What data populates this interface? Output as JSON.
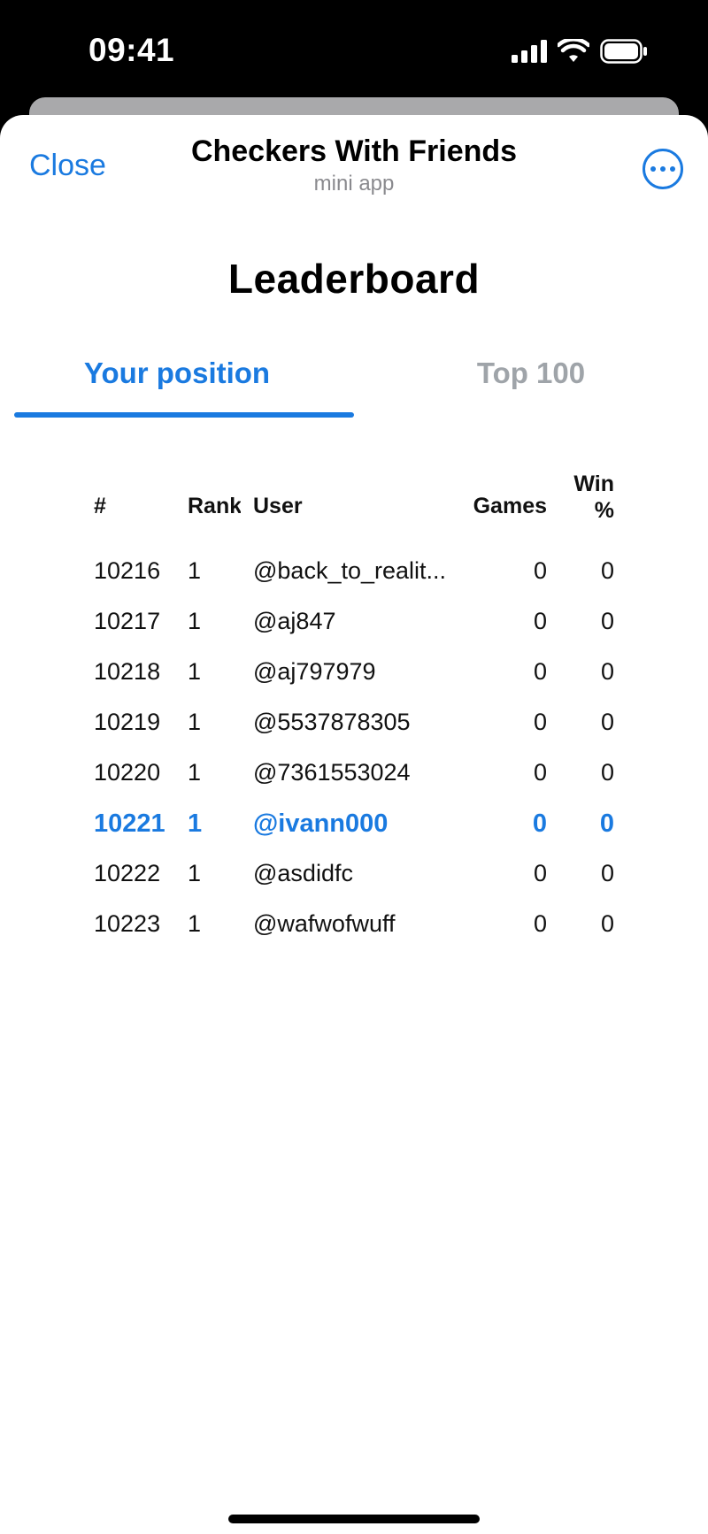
{
  "status": {
    "time": "09:41"
  },
  "app": {
    "close_label": "Close",
    "title": "Checkers With Friends",
    "subtitle": "mini app"
  },
  "page": {
    "heading": "Leaderboard"
  },
  "tabs": [
    {
      "label": "Your position",
      "active": true
    },
    {
      "label": "Top 100",
      "active": false
    }
  ],
  "table": {
    "headers": {
      "num": "#",
      "rank": "Rank",
      "user": "User",
      "games": "Games",
      "win_line1": "Win",
      "win_line2": "%"
    },
    "rows": [
      {
        "num": "10216",
        "rank": "1",
        "user": "@back_to_realit...",
        "games": "0",
        "win": "0",
        "current": false
      },
      {
        "num": "10217",
        "rank": "1",
        "user": "@aj847",
        "games": "0",
        "win": "0",
        "current": false
      },
      {
        "num": "10218",
        "rank": "1",
        "user": "@aj797979",
        "games": "0",
        "win": "0",
        "current": false
      },
      {
        "num": "10219",
        "rank": "1",
        "user": "@5537878305",
        "games": "0",
        "win": "0",
        "current": false
      },
      {
        "num": "10220",
        "rank": "1",
        "user": "@7361553024",
        "games": "0",
        "win": "0",
        "current": false
      },
      {
        "num": "10221",
        "rank": "1",
        "user": "@ivann000",
        "games": "0",
        "win": "0",
        "current": true
      },
      {
        "num": "10222",
        "rank": "1",
        "user": "@asdidfc",
        "games": "0",
        "win": "0",
        "current": false
      },
      {
        "num": "10223",
        "rank": "1",
        "user": "@wafwofwuff",
        "games": "0",
        "win": "0",
        "current": false
      }
    ]
  },
  "colors": {
    "accent": "#1a7ae0",
    "inactive_tab": "#9fa4a9",
    "subtitle": "#8a8a8e"
  },
  "icons": {
    "more": "ellipsis-circle-icon",
    "signal": "cellular-signal-icon",
    "wifi": "wifi-icon",
    "battery": "battery-icon"
  }
}
